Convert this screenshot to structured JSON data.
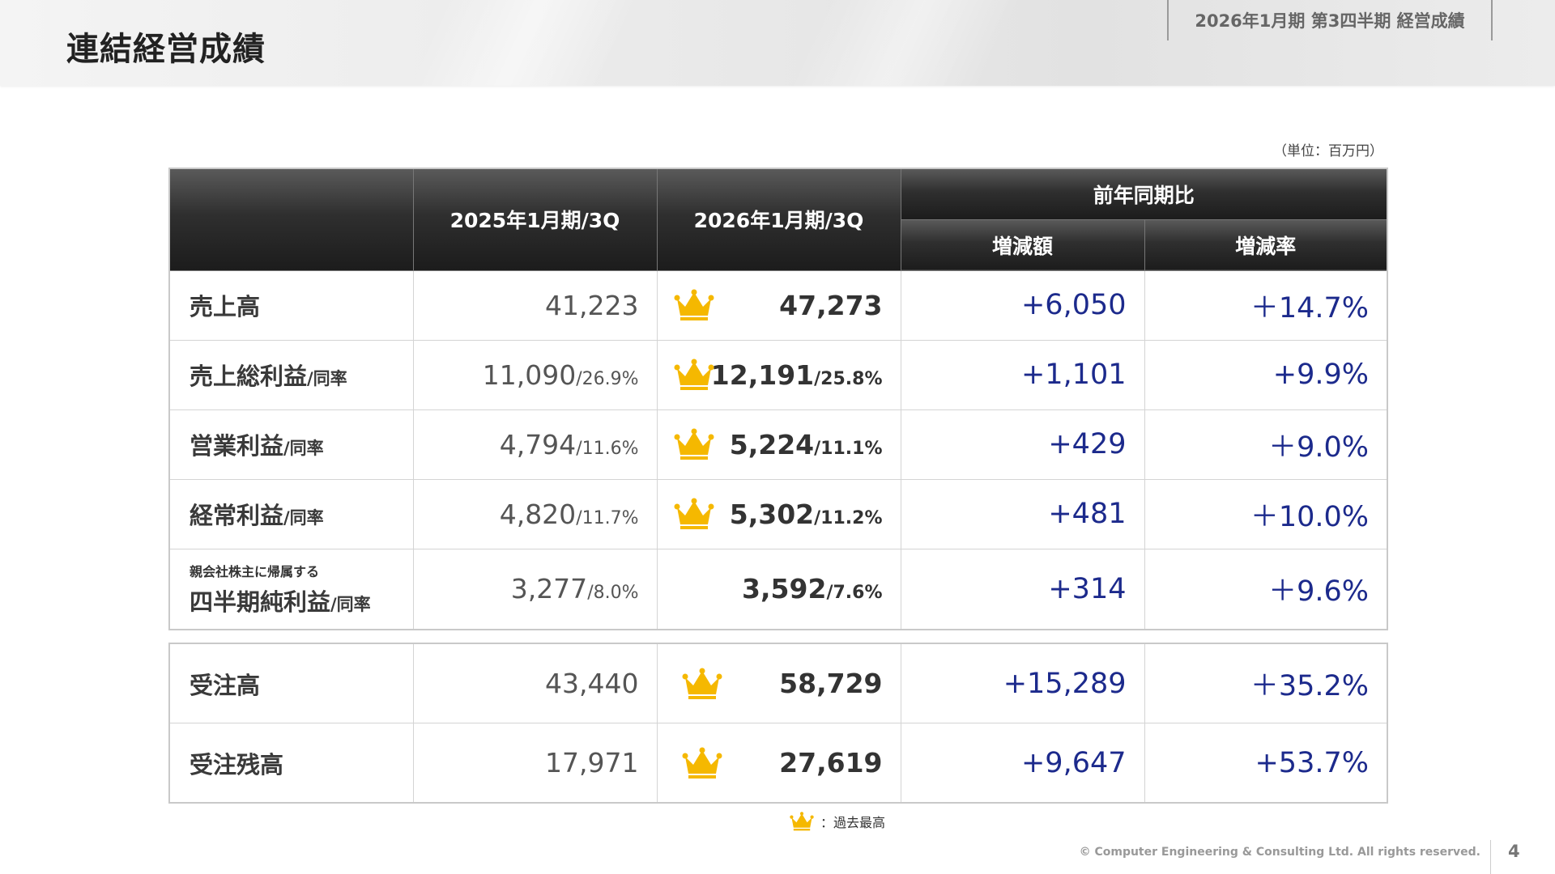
{
  "header": {
    "title": "連結経営成績",
    "period": "2026年1月期 第3四半期 経営成績"
  },
  "unit": "（単位：百万円）",
  "table": {
    "col_prev": "2025年1月期/3Q",
    "col_cur": "2026年1月期/3Q",
    "col_yoy": "前年同期比",
    "col_diff": "増減額",
    "col_rate": "増減率",
    "rows": [
      {
        "label": "売上高",
        "sub": "",
        "prev": "41,223",
        "prev_pct": "",
        "cur": "47,273",
        "cur_pct": "",
        "diff": "+6,050",
        "rate": "＋14.7%",
        "crown": true
      },
      {
        "label": "売上総利益",
        "sub": "/同率",
        "prev": "11,090",
        "prev_pct": "/26.9%",
        "cur": "12,191",
        "cur_pct": "/25.8%",
        "diff": "+1,101",
        "rate": "+9.9%",
        "crown": true
      },
      {
        "label": "営業利益",
        "sub": "/同率",
        "prev": "4,794",
        "prev_pct": "/11.6%",
        "cur": "5,224",
        "cur_pct": "/11.1%",
        "diff": "+429",
        "rate": "＋9.0%",
        "crown": true
      },
      {
        "label": "経常利益",
        "sub": "/同率",
        "prev": "4,820",
        "prev_pct": "/11.7%",
        "cur": "5,302",
        "cur_pct": "/11.2%",
        "diff": "+481",
        "rate": "＋10.0%",
        "crown": true
      },
      {
        "small": "親会社株主に帰属する",
        "label": "四半期純利益",
        "sub": "/同率",
        "prev": "3,277",
        "prev_pct": "/8.0%",
        "cur": "3,592",
        "cur_pct": "/7.6%",
        "diff": "+314",
        "rate": "＋9.6%",
        "crown": false
      }
    ],
    "orders": [
      {
        "label": "受注高",
        "prev": "43,440",
        "cur": "58,729",
        "diff": "+15,289",
        "rate": "＋35.2%",
        "crown": true
      },
      {
        "label": "受注残高",
        "prev": "17,971",
        "cur": "27,619",
        "diff": "+9,647",
        "rate": "+53.7%",
        "crown": true
      }
    ]
  },
  "legend": {
    "text": "：過去最高",
    "icon": "crown-icon"
  },
  "footer": {
    "copyright": "© Computer Engineering & Consulting Ltd. All rights reserved.",
    "page": "4"
  },
  "colors": {
    "change_text": "#1c2a8c",
    "crown": "#f5b800"
  }
}
